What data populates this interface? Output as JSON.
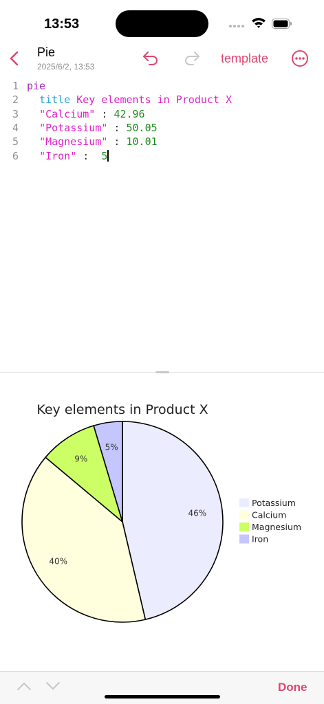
{
  "status_bar": {
    "time": "13:53"
  },
  "nav": {
    "title": "Pie",
    "date": "2025/6/2, 13:53",
    "template_label": "template"
  },
  "editor": {
    "lines": [
      {
        "num": "1",
        "parts": [
          {
            "t": "pie",
            "c": "kw"
          }
        ]
      },
      {
        "num": "2",
        "parts": [
          {
            "t": "  ",
            "c": "plain"
          },
          {
            "t": "title",
            "c": "kw2"
          },
          {
            "t": " Key elements in Product X",
            "c": "mag"
          }
        ]
      },
      {
        "num": "3",
        "parts": [
          {
            "t": "  ",
            "c": "plain"
          },
          {
            "t": "\"Calcium\"",
            "c": "mag"
          },
          {
            "t": " : ",
            "c": "plain"
          },
          {
            "t": "42.96",
            "c": "num"
          }
        ]
      },
      {
        "num": "4",
        "parts": [
          {
            "t": "  ",
            "c": "plain"
          },
          {
            "t": "\"Potassium\"",
            "c": "mag"
          },
          {
            "t": " : ",
            "c": "plain"
          },
          {
            "t": "50.05",
            "c": "num"
          }
        ]
      },
      {
        "num": "5",
        "parts": [
          {
            "t": "  ",
            "c": "plain"
          },
          {
            "t": "\"Magnesium\"",
            "c": "mag"
          },
          {
            "t": " : ",
            "c": "plain"
          },
          {
            "t": "10.01",
            "c": "num"
          }
        ]
      },
      {
        "num": "6",
        "parts": [
          {
            "t": "  ",
            "c": "plain"
          },
          {
            "t": "\"Iron\"",
            "c": "mag"
          },
          {
            "t": " :  ",
            "c": "plain"
          },
          {
            "t": "5",
            "c": "num"
          }
        ]
      }
    ]
  },
  "chart_data": {
    "type": "pie",
    "title": "Key elements in Product X",
    "slices": [
      {
        "name": "Potassium",
        "value": 50.05,
        "label": "46%",
        "color": "#ececff"
      },
      {
        "name": "Calcium",
        "value": 42.96,
        "label": "40%",
        "color": "#ffffde"
      },
      {
        "name": "Magnesium",
        "value": 10.01,
        "label": "9%",
        "color": "#ccff66"
      },
      {
        "name": "Iron",
        "value": 5,
        "label": "5%",
        "color": "#c6c6ff"
      }
    ],
    "legend_position": "right"
  },
  "toolbar": {
    "done_label": "Done"
  },
  "colors": {
    "accent": "#e0466f"
  }
}
